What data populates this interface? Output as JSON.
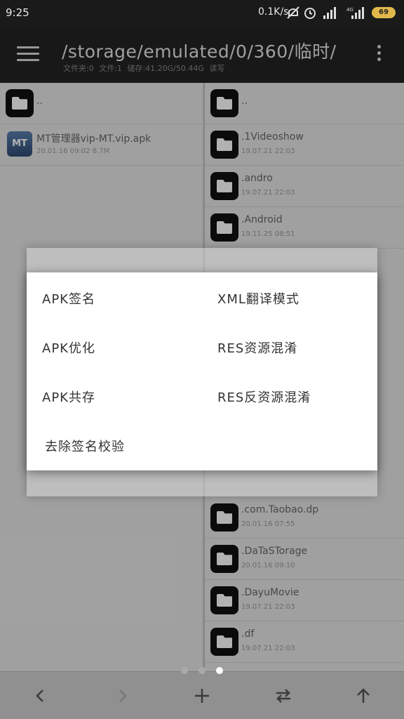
{
  "status": {
    "time": "9:25",
    "net_speed": "0.1K/s",
    "battery": "69",
    "icons": [
      "mute-icon",
      "alarm-icon",
      "signal-icon",
      "signal-4g-icon",
      "battery-icon"
    ]
  },
  "header": {
    "path": "/storage/emulated/0/360/临时/",
    "info": "文件夹:0  文件:1  储存:41.20G/50.44G  读写",
    "menu_icon": "hamburger-icon",
    "more_icon": "more-vertical-icon"
  },
  "left_pane": {
    "items": [
      {
        "name": "..",
        "meta": "",
        "type": "folder"
      },
      {
        "name": "MT管理器vip-MT.vip.apk",
        "meta": "20.01.16 09:02  8.7M",
        "type": "apk",
        "badge": "MT"
      }
    ]
  },
  "right_pane": {
    "items": [
      {
        "name": "..",
        "meta": ""
      },
      {
        "name": ".1Videoshow",
        "meta": "19.07.21 22:03"
      },
      {
        "name": ".andro",
        "meta": "19.07.21 22:03"
      },
      {
        "name": ".Android",
        "meta": "19.11.25 08:51"
      }
    ],
    "items_lower": [
      {
        "name": ".com.Taobao.dp",
        "meta": "20.01.16 07:55"
      },
      {
        "name": ".DaTaSTorage",
        "meta": "20.01.16 09:10"
      },
      {
        "name": ".DayuMovie",
        "meta": "19.07.21 22:03"
      },
      {
        "name": ".df",
        "meta": "19.07.21 22:03"
      }
    ]
  },
  "dialog": {
    "options": [
      {
        "label": "APK签名"
      },
      {
        "label": "XML翻译模式"
      },
      {
        "label": "APK优化"
      },
      {
        "label": "RES资源混淆"
      },
      {
        "label": "APK共存"
      },
      {
        "label": "RES反资源混淆"
      },
      {
        "label": "去除签名校验"
      }
    ]
  },
  "pager": {
    "count": 3,
    "active": 3
  },
  "toolbar": {
    "buttons": [
      "back-icon",
      "forward-icon",
      "add-icon",
      "swap-icon",
      "up-icon"
    ]
  }
}
